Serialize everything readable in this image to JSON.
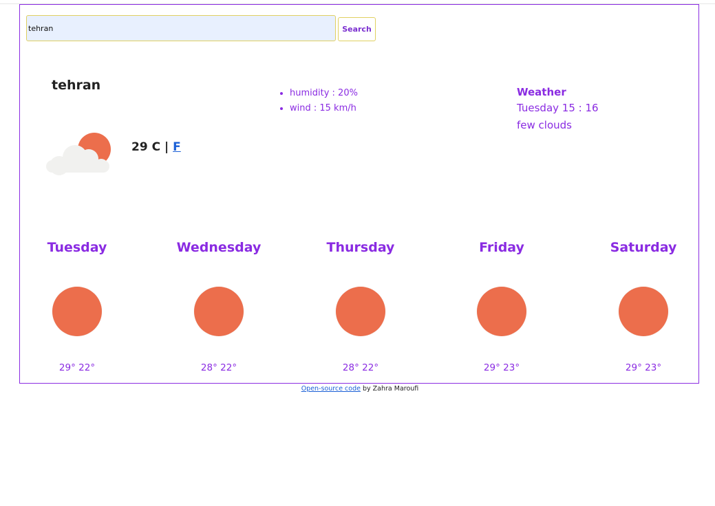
{
  "search": {
    "value": "tehran",
    "button_label": "Search"
  },
  "current": {
    "city": "tehran",
    "icon": "cloud-sun-icon",
    "temperature": "29",
    "unit_c": "C",
    "separator": "|",
    "unit_f_link": "F",
    "details": [
      "humidity : 20%",
      "wind : 15 km/h"
    ]
  },
  "weather": {
    "title": "Weather",
    "datetime": "Tuesday 15 : 16",
    "description": "few clouds"
  },
  "forecast": [
    {
      "day": "Tuesday",
      "icon": "sun-icon",
      "temps": "29° 22°"
    },
    {
      "day": "Wednesday",
      "icon": "sun-icon",
      "temps": "28° 22°"
    },
    {
      "day": "Thursday",
      "icon": "sun-icon",
      "temps": "28° 22°"
    },
    {
      "day": "Friday",
      "icon": "sun-icon",
      "temps": "29° 23°"
    },
    {
      "day": "Saturday",
      "icon": "sun-icon",
      "temps": "29° 23°"
    }
  ],
  "footer": {
    "link_text": "Open-source code",
    "suffix": " by Zahra Maroufi"
  },
  "colors": {
    "accent": "#8a2be2",
    "sun": "#ec6e4c",
    "input_bg": "#e8f0fe",
    "input_border": "#e0d060",
    "link": "#1a5fd6"
  }
}
